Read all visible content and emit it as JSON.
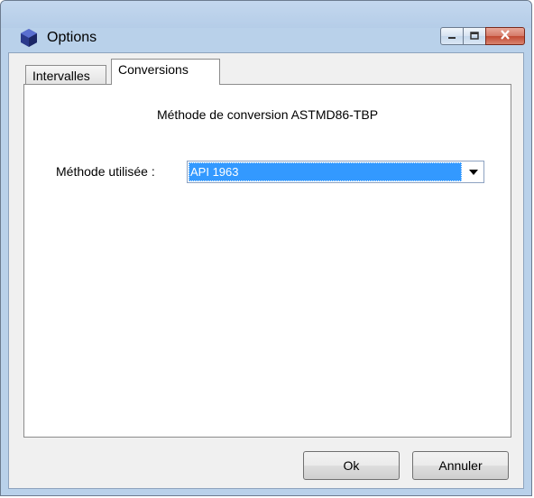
{
  "window": {
    "title": "Options",
    "icon": "app-logo-icon",
    "minimize_icon": "minimize-icon",
    "maximize_icon": "maximize-icon",
    "close_icon": "close-icon"
  },
  "tabs": [
    {
      "label": "Intervalles",
      "active": false
    },
    {
      "label": "Conversions",
      "active": true
    }
  ],
  "conversions": {
    "section_title": "Méthode de conversion ASTMD86-TBP",
    "method_label": "Méthode utilisée :",
    "method_value": "API 1963"
  },
  "buttons": {
    "ok_label": "Ok",
    "cancel_label": "Annuler"
  },
  "colors": {
    "frame": "#b9d1ea",
    "selection": "#3399ff",
    "close_button": "#c14a32"
  }
}
